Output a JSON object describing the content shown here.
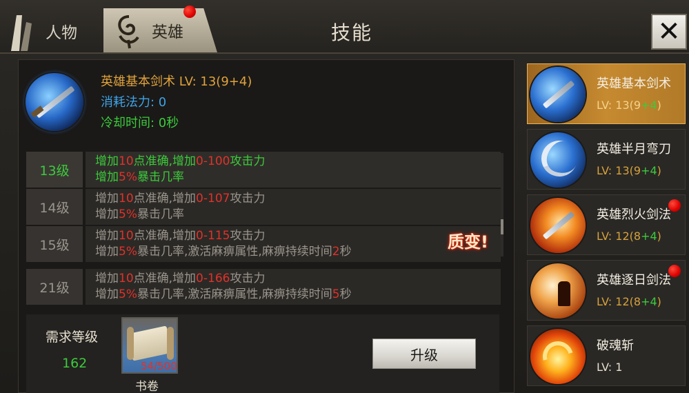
{
  "header": {
    "tabs": [
      {
        "label": "人物",
        "selected": false
      },
      {
        "label": "英雄",
        "selected": true,
        "notification": true
      }
    ],
    "title": "技能",
    "close_label": "✕"
  },
  "selected_skill": {
    "name_level": "英雄基本剑术 LV: 13(9+4)",
    "mp_cost": "消耗法力: 0",
    "cooldown": "冷却时间: 0秒",
    "icon": "sword-icon"
  },
  "level_rows": [
    {
      "level": "13级",
      "active": true,
      "line1": [
        "增加",
        "10",
        "点准确,增加",
        "0-100",
        "攻击力"
      ],
      "line2": [
        "增加",
        "5%",
        "暴击几率"
      ]
    },
    {
      "level": "14级",
      "active": false,
      "line1": [
        "增加",
        "10",
        "点准确,增加",
        "0-107",
        "攻击力"
      ],
      "line2": [
        "增加",
        "5%",
        "暴击几率"
      ]
    },
    {
      "level": "15级",
      "active": false,
      "line1": [
        "增加",
        "10",
        "点准确,增加",
        "0-115",
        "攻击力"
      ],
      "line2": [
        "增加",
        "5%",
        "暴击几率,激活麻痹属性,麻痹持续时间",
        "2",
        "秒"
      ],
      "badge": "质变!"
    },
    {
      "level": "21级",
      "active": false,
      "line1": [
        "增加",
        "10",
        "点准确,增加",
        "0-166",
        "攻击力"
      ],
      "line2": [
        "增加",
        "5%",
        "暴击几率,激活麻痹属性,麻痹持续时间",
        "5",
        "秒"
      ]
    }
  ],
  "requirements": {
    "req_level_label": "需求等级",
    "req_level_value": "162",
    "book_count": "54/500",
    "book_name": "书卷",
    "upgrade_label": "升级"
  },
  "skill_list": [
    {
      "name": "英雄基本剑术",
      "level_base": "LV: 13(9",
      "level_plus": "+4",
      "level_end": ")",
      "selected": true,
      "notification": false,
      "icon": "sword-icon"
    },
    {
      "name": "英雄半月弯刀",
      "level_base": "LV: 13(9",
      "level_plus": "+4",
      "level_end": ")",
      "selected": false,
      "notification": false,
      "icon": "crescent-blade-icon"
    },
    {
      "name": "英雄烈火剑法",
      "level_base": "LV: 12(8",
      "level_plus": "+4",
      "level_end": ")",
      "selected": false,
      "notification": true,
      "icon": "fire-sword-icon"
    },
    {
      "name": "英雄逐日剑法",
      "level_base": "LV: 12(8",
      "level_plus": "+4",
      "level_end": ")",
      "selected": false,
      "notification": true,
      "icon": "sun-chase-icon"
    },
    {
      "name": "破魂斩",
      "level_plain": "LV: 1",
      "selected": false,
      "notification": false,
      "icon": "soul-break-icon"
    }
  ],
  "colors": {
    "green": "#3ccb3c",
    "red": "#e0322a",
    "orange": "#e1a23c",
    "blue": "#3fa3e8",
    "selected_gold": "#c68a30"
  }
}
